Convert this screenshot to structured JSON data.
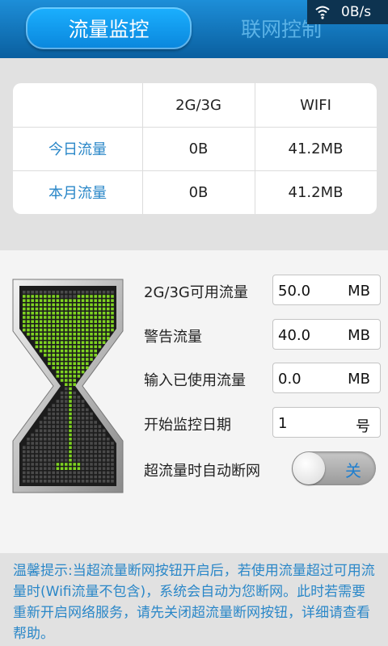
{
  "tabs": [
    {
      "label": "流量监控",
      "active": true
    },
    {
      "label": "联网控制",
      "active": false
    }
  ],
  "status_bar": {
    "speed": "0B/s",
    "icon": "wifi-icon"
  },
  "stats": {
    "headers": [
      "",
      "2G/3G",
      "WIFI"
    ],
    "rows": [
      {
        "label": "今日流量",
        "mobile": "0B",
        "wifi": "41.2MB"
      },
      {
        "label": "本月流量",
        "mobile": "0B",
        "wifi": "41.2MB"
      }
    ]
  },
  "settings": {
    "available": {
      "label": "2G/3G可用流量",
      "value": "50.0",
      "unit": "MB"
    },
    "warning": {
      "label": "警告流量",
      "value": "40.0",
      "unit": "MB"
    },
    "used": {
      "label": "输入已使用流量",
      "value": "0.0",
      "unit": "MB"
    },
    "start_date": {
      "label": "开始监控日期",
      "value": "1",
      "unit": "号"
    },
    "auto_disconnect": {
      "label": "超流量时自动断网",
      "state": "关",
      "on": false
    }
  },
  "tip": "温馨提示:当超流量断网按钮开启后，若使用流量超过可用流量时(Wifi流量不包含)，系统会自动为您断网。此时若需要重新开启网络服务，请先关闭超流量断网按钮，详细请查看帮助。",
  "colors": {
    "accent": "#2a87c8",
    "tab_bar": "#0a5f9f",
    "hourglass_green": "#7ed321"
  }
}
